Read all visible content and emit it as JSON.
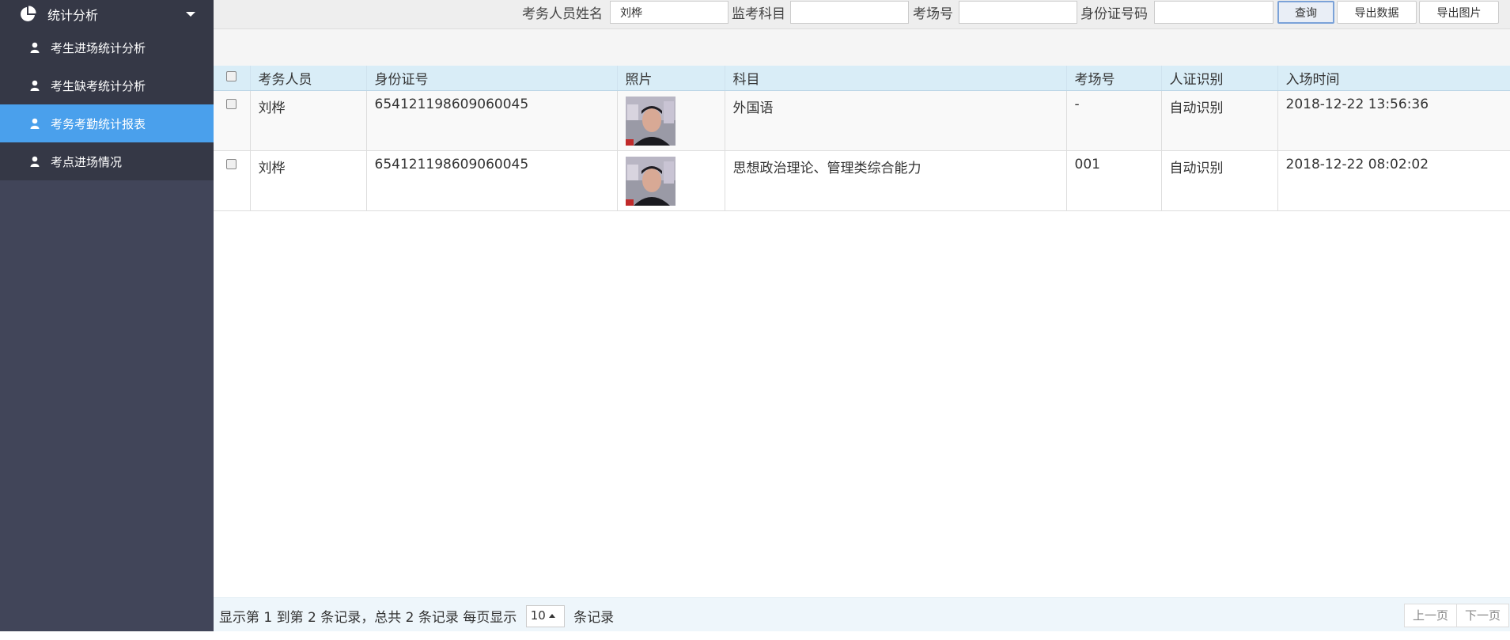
{
  "sidebar": {
    "header": {
      "label": "统计分析",
      "icon": "pie-chart-icon"
    },
    "items": [
      {
        "label": "考生进场统计分析",
        "icon": "user-icon",
        "active": false
      },
      {
        "label": "考生缺考统计分析",
        "icon": "user-icon",
        "active": false
      },
      {
        "label": "考务考勤统计报表",
        "icon": "user-icon",
        "active": true
      },
      {
        "label": "考点进场情况",
        "icon": "user-icon",
        "active": false
      }
    ]
  },
  "search": {
    "name_label": "考务人员姓名",
    "name_value": "刘桦",
    "subject_label": "监考科目",
    "subject_value": "",
    "room_label": "考场号",
    "room_value": "",
    "idcard_label": "身份证号码",
    "idcard_value": "",
    "query_button": "查询",
    "export_data_button": "导出数据",
    "export_image_button": "导出图片"
  },
  "table": {
    "columns": [
      "考务人员",
      "身份证号",
      "照片",
      "科目",
      "考场号",
      "人证识别",
      "入场时间"
    ],
    "rows": [
      {
        "name": "刘桦",
        "id_number": "654121198609060045",
        "subject": "外国语",
        "room": "-",
        "verify": "自动识别",
        "time": "2018-12-22 13:56:36"
      },
      {
        "name": "刘桦",
        "id_number": "654121198609060045",
        "subject": "思想政治理论、管理类综合能力",
        "room": "001",
        "verify": "自动识别",
        "time": "2018-12-22 08:02:02"
      }
    ]
  },
  "footer": {
    "summary": "显示第 1 到第 2 条记录，总共 2 条记录 每页显示",
    "page_size": "10",
    "suffix": "条记录",
    "prev_label": "上一页",
    "next_label": "下一页"
  },
  "colors": {
    "sidebar_bg": "#414559",
    "sidebar_active": "#4aa0ec",
    "table_header_bg": "#d9edf7"
  }
}
